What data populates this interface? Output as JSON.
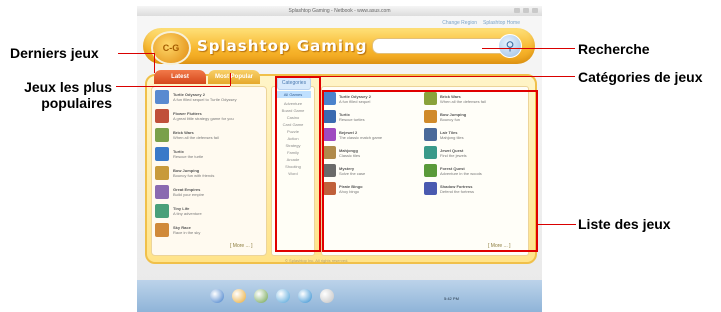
{
  "window": {
    "title": "Splashtop Gaming - Netbook - www.asus.com"
  },
  "top_links": [
    "Change Region",
    "Splashtop Home"
  ],
  "brand": "Splashtop Gaming",
  "logo_text": "C-G",
  "search": {
    "placeholder": ""
  },
  "tabs": {
    "latest": "Latest",
    "popular": "Most Popular"
  },
  "latest_games": [
    {
      "title": "Turtle Odyssey 2",
      "desc": "A fun filled sequel to Turtle Odyssey",
      "color": "#5a8ad0"
    },
    {
      "title": "Flower Flutters",
      "desc": "A great little strategy game for you",
      "color": "#c0503a"
    },
    {
      "title": "Brick Wars",
      "desc": "When all the defenses fail",
      "color": "#7aa04a"
    },
    {
      "title": "Turtix",
      "desc": "Rescue the turtle",
      "color": "#3a7ac8"
    },
    {
      "title": "Bow Jumping",
      "desc": "Bouncy fun with friends",
      "color": "#c89a3a"
    },
    {
      "title": "Great Empires",
      "desc": "Build your empire",
      "color": "#8a6ab0"
    },
    {
      "title": "Tiny Life",
      "desc": "A tiny adventure",
      "color": "#4aa07a"
    },
    {
      "title": "Sky Race",
      "desc": "Race in the sky",
      "color": "#d08a3a"
    }
  ],
  "left_more": "[ More ... ]",
  "categories": {
    "header": "Categories",
    "items": [
      "All Games",
      "Adventure",
      "Board Game",
      "Casino",
      "Card Game",
      "Puzzle",
      "Action",
      "Strategy",
      "Family",
      "Arcade",
      "Shooting",
      "Word"
    ]
  },
  "games": [
    {
      "title": "Turtle Odyssey 2",
      "desc": "A fun filled sequel",
      "color": "#4a82cc"
    },
    {
      "title": "Brick Wars",
      "desc": "When all the defenses fail",
      "color": "#8aa23a"
    },
    {
      "title": "Turtix",
      "desc": "Rescue turtles",
      "color": "#3a6ab0"
    },
    {
      "title": "Bow Jumping",
      "desc": "Bouncy fun",
      "color": "#d08a2a"
    },
    {
      "title": "Bejewel 2",
      "desc": "The classic match game",
      "color": "#a04ac0"
    },
    {
      "title": "Lair Tiles",
      "desc": "Mahjong tiles",
      "color": "#4a6a9a"
    },
    {
      "title": "Mahjongg",
      "desc": "Classic tiles",
      "color": "#b08a4a"
    },
    {
      "title": "Jewel Quest",
      "desc": "Find the jewels",
      "color": "#3a9a8a"
    },
    {
      "title": "Mystery",
      "desc": "Solve the case",
      "color": "#6a6a6a"
    },
    {
      "title": "Forest Quest",
      "desc": "Adventure in the woods",
      "color": "#5a9a3a"
    },
    {
      "title": "Pirate Bingo",
      "desc": "Ahoy bingo",
      "color": "#c0603a"
    },
    {
      "title": "Shadow Fortress",
      "desc": "Defend the fortress",
      "color": "#4a5ab0"
    }
  ],
  "grid_more": "[ More ... ]",
  "footnote": "© Splashtop Inc. All rights reserved.",
  "taskbar": {
    "icons": [
      {
        "name": "browser",
        "color": "#3a78c8"
      },
      {
        "name": "photo",
        "color": "#e8a830"
      },
      {
        "name": "music",
        "color": "#6aa04a"
      },
      {
        "name": "chat",
        "color": "#4aa0d8"
      },
      {
        "name": "skype",
        "color": "#2a8ad0"
      },
      {
        "name": "games",
        "color": "#c0c0c0"
      }
    ],
    "clock": "5:42 PM"
  },
  "annotations": {
    "latest_games": "Derniers jeux",
    "popular_games": "Jeux les plus populaires",
    "search": "Recherche",
    "categories": "Catégories de jeux",
    "games_list": "Liste des jeux"
  }
}
